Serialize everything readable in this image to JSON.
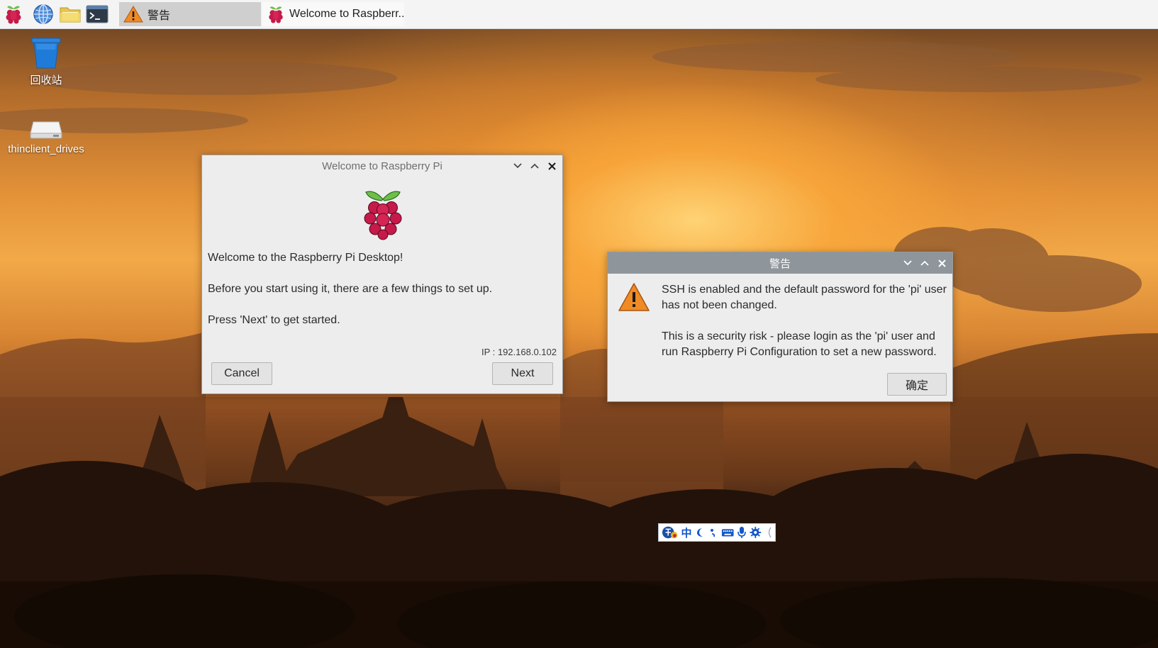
{
  "taskbar": {
    "launchers": [
      {
        "name": "raspberry-menu",
        "icon": "raspberry-icon"
      },
      {
        "name": "web-browser",
        "icon": "globe-icon"
      },
      {
        "name": "file-manager",
        "icon": "folder-icon"
      },
      {
        "name": "terminal",
        "icon": "terminal-icon"
      }
    ],
    "tasks": [
      {
        "label": "警告",
        "icon": "warning-icon",
        "state": "inactive"
      },
      {
        "label": "Welcome to Raspberr...",
        "icon": "raspberry-icon",
        "state": "active"
      }
    ]
  },
  "desktop": {
    "icons": [
      {
        "label": "回收站",
        "icon": "trash-icon"
      },
      {
        "label": "thinclient_drives",
        "icon": "drive-icon"
      }
    ]
  },
  "welcome_window": {
    "title": "Welcome to Raspberry Pi",
    "heading": "Welcome to the Raspberry Pi Desktop!",
    "line1": "Before you start using it, there are a few things to set up.",
    "line2": "Press 'Next' to get started.",
    "ip": "IP : 192.168.0.102",
    "cancel_label": "Cancel",
    "next_label": "Next"
  },
  "warning_window": {
    "title": "警告",
    "message_line1": "SSH is enabled and the default password for the 'pi' user",
    "message_line2": "has not been changed.",
    "message_line3": "This is a security risk - please login as the 'pi' user and",
    "message_line4": "run Raspberry Pi Configuration to set a new password.",
    "ok_label": "确定"
  },
  "ime_bar": {
    "mode_label": "中"
  },
  "colors": {
    "taskbar_bg": "#f4f4f4",
    "window_bg": "#ededed",
    "warning_title_bg": "#8e959b",
    "raspberry_red": "#c51a4a",
    "leaf_green": "#6cc04a",
    "warning_orange": "#f08a24",
    "trash_blue": "#1f7bd8"
  }
}
